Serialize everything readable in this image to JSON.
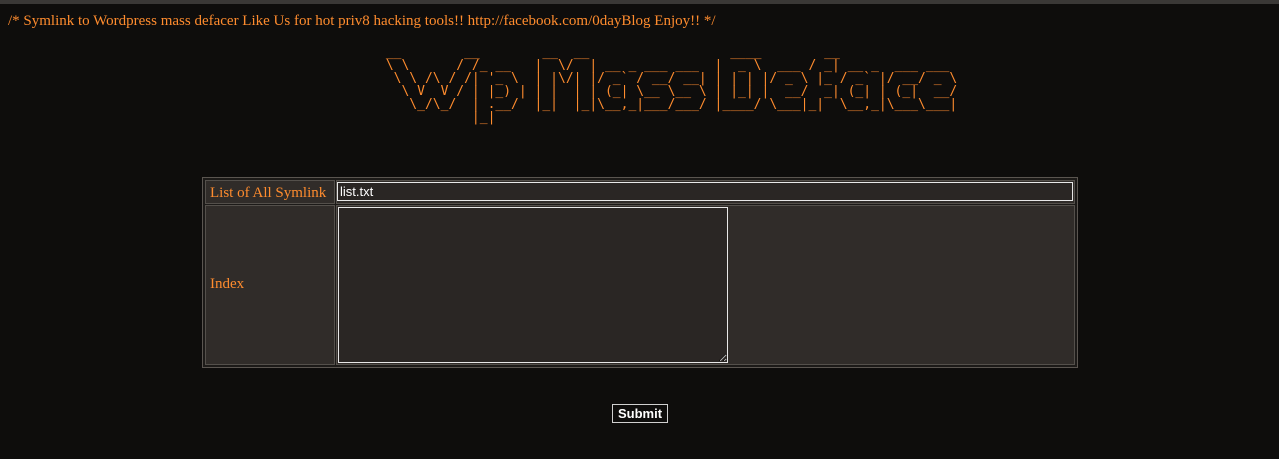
{
  "header": {
    "text": "/* Symlink to Wordpress mass defacer Like Us for hot priv8 hacking tools!! http://facebook.com/0dayBlog Enjoy!! */"
  },
  "banner": {
    "ascii_art": " __        __        __  __                  ____        __\n \\ \\      / /_ __   |  \\/  | __ _ ___ ___  |  _ \\  ___ / _| __ _  ___ ___\n  \\ \\ /\\ / /| '_ \\  | |\\/| |/ _` / __/ __| | | | |/ _ \\ |_ / _` |/ __/ _ \\\n   \\ V  V / | |_) | | |  | | (_| \\__ \\__ \\ | |_| |  __/  _| (_| | (_|  __/\n    \\_/\\_/  | .__/  |_|  |_|\\__,_|___/___/ |____/ \\___|_|  \\__,_|\\___\\___|\n            |_|"
  },
  "form": {
    "symlink_label": "List of All Symlink",
    "symlink_value": "list.txt",
    "index_label": "Index",
    "index_value": "",
    "submit_label": "Submit"
  },
  "colors": {
    "background": "#0e0d0c",
    "accent": "#ff8c2e",
    "cell_background": "#302c29"
  }
}
